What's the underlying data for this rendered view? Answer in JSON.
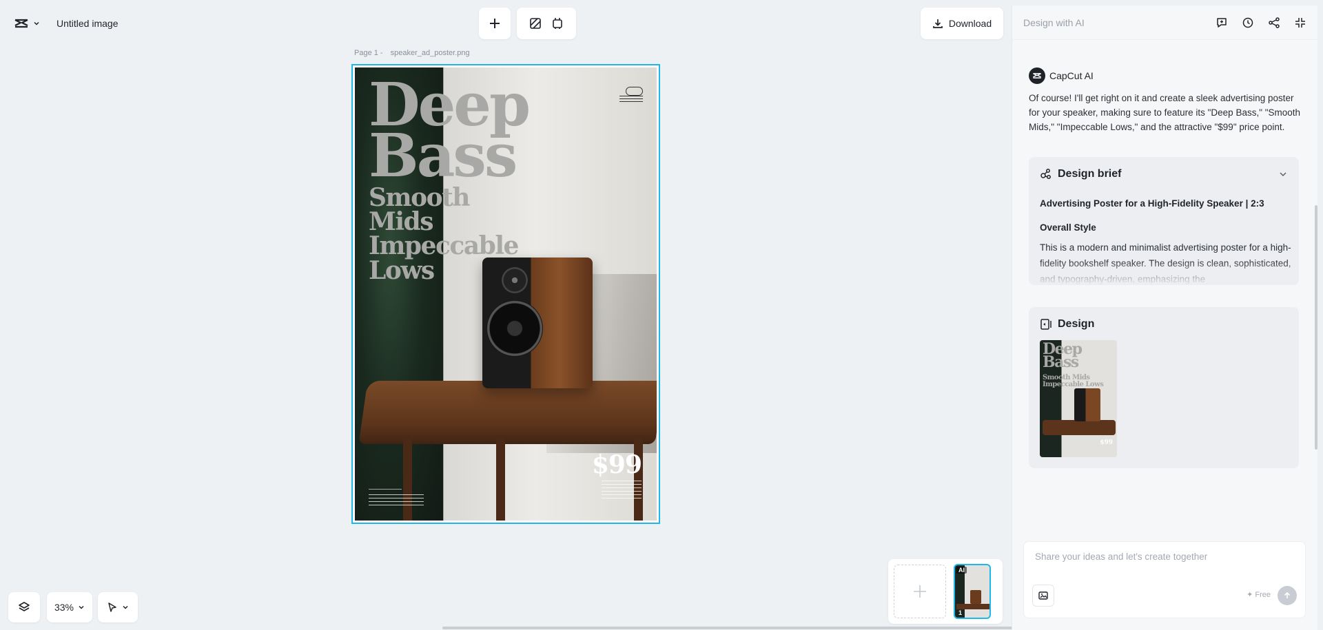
{
  "header": {
    "title": "Untitled image",
    "download_label": "Download"
  },
  "canvas": {
    "page_label": "Page 1 -",
    "file_name": "speaker_ad_poster.png",
    "poster": {
      "headline_1": "Deep",
      "headline_2": "Bass",
      "sub_1": "Smooth",
      "sub_2": "Mids",
      "sub_3": "Impeccable",
      "sub_4": "Lows",
      "price": "$99"
    }
  },
  "controls": {
    "zoom": "33%"
  },
  "pages": {
    "thumb_tag": "AI",
    "thumb_number": "1"
  },
  "panel": {
    "title": "Design with AI",
    "author": "CapCut AI",
    "message": "Of course! I'll get right on it and create a sleek advertising poster for your speaker, making sure to feature its \"Deep Bass,\" \"Smooth Mids,\" \"Impeccable Lows,\" and the attractive \"$99\" price point.",
    "brief": {
      "heading": "Design brief",
      "subtitle": "Advertising Poster for a High-Fidelity Speaker | 2:3",
      "section_title": "Overall Style",
      "section_text": "This is a modern and minimalist advertising poster for a high-fidelity bookshelf speaker. The design is clean, sophisticated, and typography-driven, emphasizing the"
    },
    "design": {
      "heading": "Design",
      "thumb_head": "Deep Bass",
      "thumb_sub": "Smooth Mids Impeccable Lows",
      "thumb_price": "$99"
    },
    "composer": {
      "placeholder": "Share your ideas and let's create together",
      "free_label": "✦ Free"
    }
  },
  "colors": {
    "accent": "#1fb6e8",
    "background": "#eef1f4",
    "panel": "#f6f7f8"
  }
}
